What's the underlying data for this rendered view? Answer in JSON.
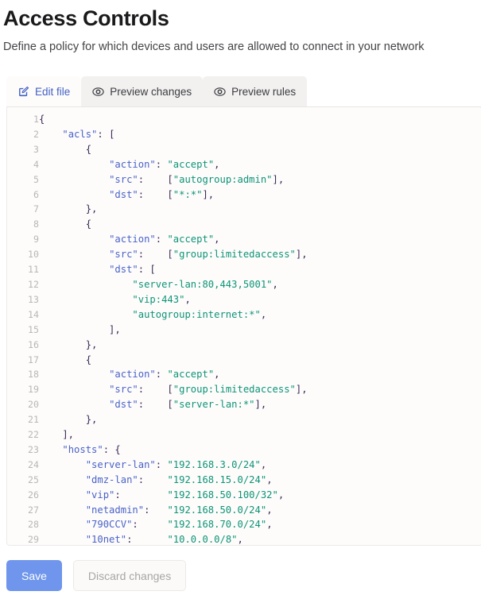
{
  "header": {
    "title": "Access Controls",
    "subtitle": "Define a policy for which devices and users are allowed to connect in your network"
  },
  "tabs": [
    {
      "id": "edit-file",
      "label": "Edit file",
      "icon": "pencil-square-icon",
      "active": true
    },
    {
      "id": "preview-changes",
      "label": "Preview changes",
      "icon": "eye-icon",
      "active": false
    },
    {
      "id": "preview-rules",
      "label": "Preview rules",
      "icon": "eye-icon",
      "active": false
    }
  ],
  "editor": {
    "language": "json",
    "first_visible_line": 1,
    "last_visible_line": 29,
    "lines": [
      {
        "n": 1,
        "text": "{"
      },
      {
        "n": 2,
        "text": "    \"acls\": ["
      },
      {
        "n": 3,
        "text": "        {"
      },
      {
        "n": 4,
        "text": "            \"action\": \"accept\","
      },
      {
        "n": 5,
        "text": "            \"src\":    [\"autogroup:admin\"],"
      },
      {
        "n": 6,
        "text": "            \"dst\":    [\"*:*\"],"
      },
      {
        "n": 7,
        "text": "        },"
      },
      {
        "n": 8,
        "text": "        {"
      },
      {
        "n": 9,
        "text": "            \"action\": \"accept\","
      },
      {
        "n": 10,
        "text": "            \"src\":    [\"group:limitedaccess\"],"
      },
      {
        "n": 11,
        "text": "            \"dst\": ["
      },
      {
        "n": 12,
        "text": "                \"server-lan:80,443,5001\","
      },
      {
        "n": 13,
        "text": "                \"vip:443\","
      },
      {
        "n": 14,
        "text": "                \"autogroup:internet:*\","
      },
      {
        "n": 15,
        "text": "            ],"
      },
      {
        "n": 16,
        "text": "        },"
      },
      {
        "n": 17,
        "text": "        {"
      },
      {
        "n": 18,
        "text": "            \"action\": \"accept\","
      },
      {
        "n": 19,
        "text": "            \"src\":    [\"group:limitedaccess\"],"
      },
      {
        "n": 20,
        "text": "            \"dst\":    [\"server-lan:*\"],"
      },
      {
        "n": 21,
        "text": "        },"
      },
      {
        "n": 22,
        "text": "    ],"
      },
      {
        "n": 23,
        "text": "    \"hosts\": {"
      },
      {
        "n": 24,
        "text": "        \"server-lan\": \"192.168.3.0/24\","
      },
      {
        "n": 25,
        "text": "        \"dmz-lan\":    \"192.168.15.0/24\","
      },
      {
        "n": 26,
        "text": "        \"vip\":        \"192.168.50.100/32\","
      },
      {
        "n": 27,
        "text": "        \"netadmin\":   \"192.168.50.0/24\","
      },
      {
        "n": 28,
        "text": "        \"790CCV\":     \"192.168.70.0/24\","
      },
      {
        "n": 29,
        "text": "        \"10net\":      \"10.0.0.0/8\","
      }
    ]
  },
  "footer": {
    "save_label": "Save",
    "discard_label": "Discard changes"
  },
  "colors": {
    "accent": "#4361c4",
    "save_button": "#6f96ec",
    "json_key": "#4a62c8",
    "json_string": "#0e9477",
    "json_punct": "#3b2a55",
    "tab_inactive_bg": "#f2f1f0",
    "editor_bg": "#fdfcfb"
  }
}
